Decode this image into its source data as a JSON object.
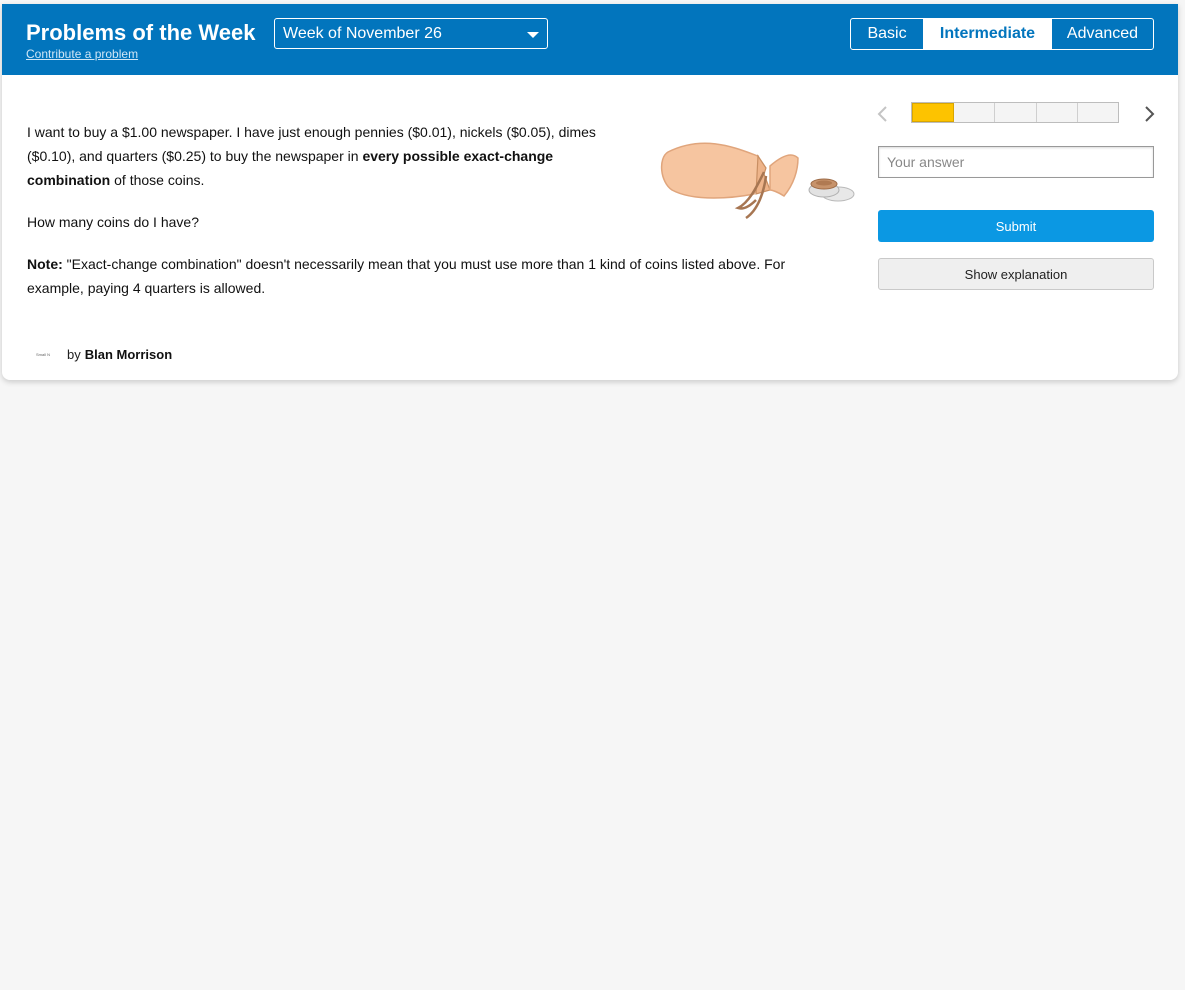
{
  "header": {
    "title": "Problems of the Week",
    "contribute_link": "Contribute a problem",
    "week_selector": {
      "selected": "Week of November 26"
    },
    "levels": [
      {
        "label": "Basic",
        "active": false
      },
      {
        "label": "Intermediate",
        "active": true
      },
      {
        "label": "Advanced",
        "active": false
      }
    ],
    "accent_color": "#0275bd"
  },
  "problem": {
    "p1_text_a": "I want to buy a $1.00 newspaper. I have just enough pennies ($0.01), nickels ($0.05), dimes ($0.10), and quarters ($0.25) to buy the newspaper in ",
    "p1_bold": "every possible exact-change combination",
    "p1_text_b": " of those coins.",
    "question": "How many coins do I have?",
    "note_label": "Note:",
    "note_text": " \"Exact-change combination\" doesn't necessarily mean that you must use more than 1 kind of coins listed above. For example, paying 4 quarters is allowed.",
    "illustration": "coin-bag-illustration"
  },
  "author": {
    "by": "by",
    "name": "Blan Morrison",
    "avatar_text": "Small N"
  },
  "answer_panel": {
    "progress": {
      "segments": 5,
      "completed": 1,
      "completed_color": "#fdc300"
    },
    "answer_placeholder": "Your answer",
    "submit_label": "Submit",
    "submit_color": "#0b98e3",
    "explanation_label": "Show explanation",
    "prev_icon": "chevron-left-icon",
    "next_icon": "chevron-right-icon"
  }
}
